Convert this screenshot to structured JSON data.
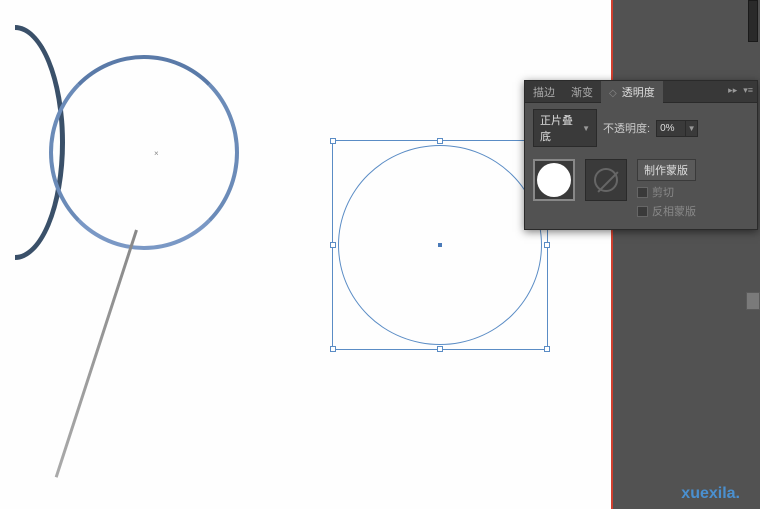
{
  "panel": {
    "tabs": {
      "stroke": "描边",
      "gradient": "渐变",
      "transparency": "透明度"
    },
    "blend_mode": {
      "value": "正片叠底"
    },
    "opacity": {
      "label": "不透明度:",
      "value": "0%"
    },
    "mask": {
      "make_mask": "制作蒙版",
      "clip": "剪切",
      "invert": "反相蒙版"
    }
  },
  "watermark": {
    "text_blue": "xuexila.",
    "text_orange": ""
  }
}
